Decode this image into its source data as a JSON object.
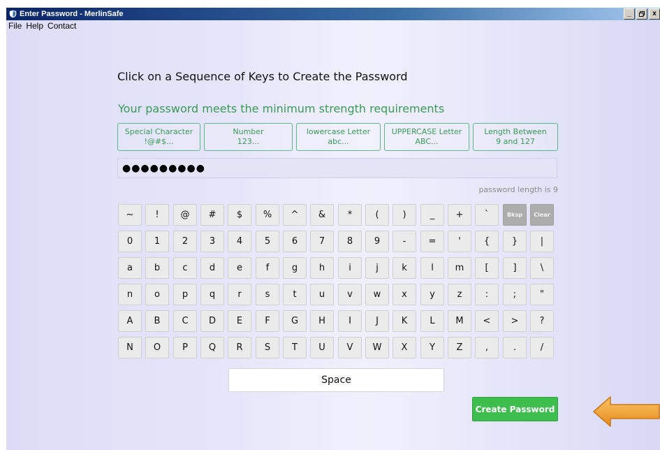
{
  "window": {
    "title": "Enter Password - MerlinSafe",
    "controls": [
      "_",
      " ",
      "x"
    ]
  },
  "menu": [
    "File",
    "Help",
    "Contact"
  ],
  "instructions": "Click on a Sequence of Keys to Create the Password",
  "strength_message": "Your password meets the minimum strength requirements",
  "requirements": [
    {
      "line1": "Special Character",
      "line2": "!@#$..."
    },
    {
      "line1": "Number",
      "line2": "123..."
    },
    {
      "line1": "lowercase Letter",
      "line2": "abc..."
    },
    {
      "line1": "UPPERCASE Letter",
      "line2": "ABC..."
    },
    {
      "line1": "Length Between",
      "line2": "9 and 127"
    }
  ],
  "password_field": {
    "value": "●●●●●●●●●"
  },
  "password_length_text": "password length is 9",
  "keyboard": {
    "rows": [
      [
        "~",
        "!",
        "@",
        "#",
        "$",
        "%",
        "^",
        "&",
        "*",
        "(",
        ")",
        "_",
        "+",
        "`",
        "Bksp",
        "Clear"
      ],
      [
        "0",
        "1",
        "2",
        "3",
        "4",
        "5",
        "6",
        "7",
        "8",
        "9",
        "-",
        "=",
        "'",
        "{",
        "}",
        "|"
      ],
      [
        "a",
        "b",
        "c",
        "d",
        "e",
        "f",
        "g",
        "h",
        "i",
        "j",
        "k",
        "l",
        "m",
        "[",
        "]",
        "\\"
      ],
      [
        "n",
        "o",
        "p",
        "q",
        "r",
        "s",
        "t",
        "u",
        "v",
        "w",
        "x",
        "y",
        "z",
        ":",
        ";",
        "\""
      ],
      [
        "A",
        "B",
        "C",
        "D",
        "E",
        "F",
        "G",
        "H",
        "I",
        "J",
        "K",
        "L",
        "M",
        "<",
        ">",
        "?"
      ],
      [
        "N",
        "O",
        "P",
        "Q",
        "R",
        "S",
        "T",
        "U",
        "V",
        "W",
        "X",
        "Y",
        "Z",
        ",",
        ".",
        "/"
      ]
    ],
    "space_label": "Space"
  },
  "create_button": "Create Password",
  "colors": {
    "accent_green": "#3a9a57",
    "button_green": "#3ebe4e",
    "arrow_orange": "#f4a02a",
    "titlebar_blue": "#0a246a"
  }
}
